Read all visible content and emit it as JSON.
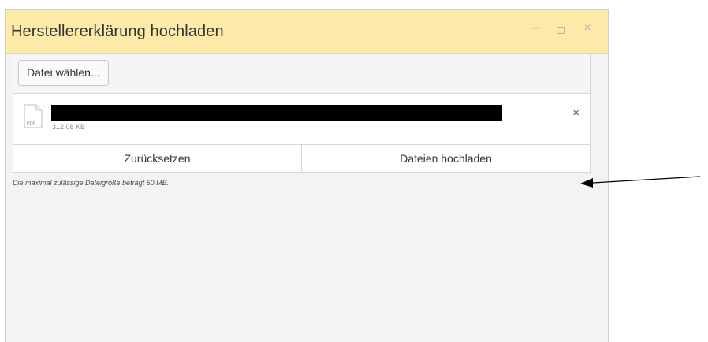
{
  "window": {
    "title": "Herstellererklärung hochladen",
    "minimize_symbol": "–",
    "close_symbol": "×",
    "header_color": "#fdeaa9"
  },
  "upload": {
    "select_button_label": "Datei wählen...",
    "file": {
      "type_label": "PDF",
      "size": "312.08 KB",
      "remove_symbol": "×",
      "name_redacted": true
    },
    "reset_button_label": "Zurücksetzen",
    "upload_button_label": "Dateien hochladen",
    "hint": "Die maximal zulässige Dateigröße beträgt 50 MB."
  },
  "annotation": {
    "type": "arrow",
    "points_to": "upload-button",
    "color": "#000000"
  }
}
